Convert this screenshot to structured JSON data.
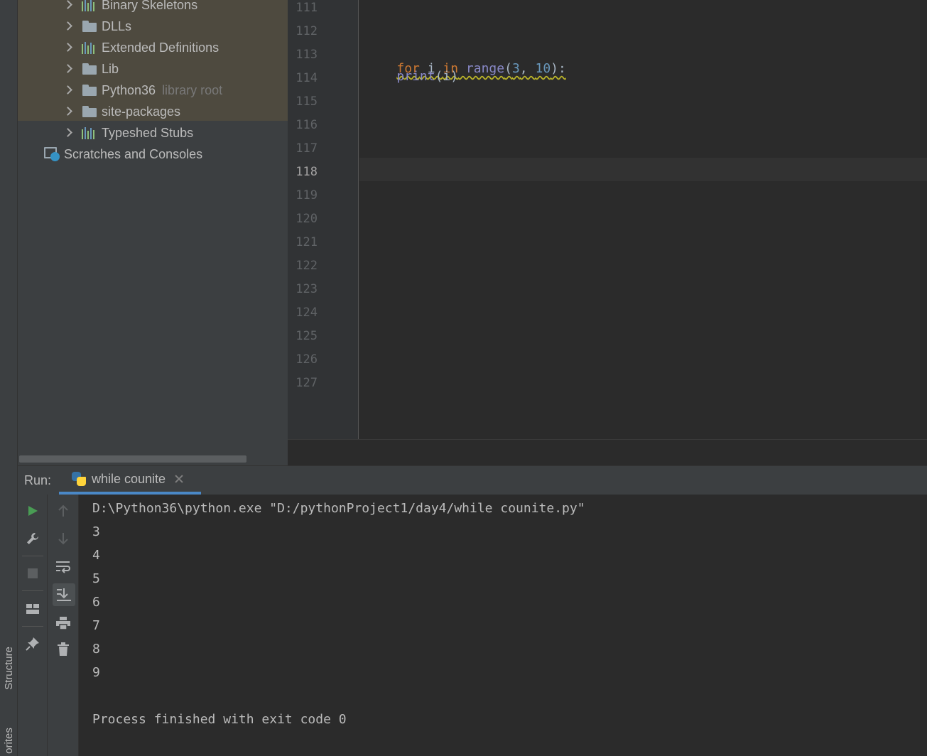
{
  "left_strip": {
    "structure_label": "Structure",
    "favorites_label": "orites"
  },
  "project_tree": {
    "items": [
      {
        "label": "Binary Skeletons",
        "icon": "library-icon"
      },
      {
        "label": "DLLs",
        "icon": "folder-icon"
      },
      {
        "label": "Extended Definitions",
        "icon": "library-icon"
      },
      {
        "label": "Lib",
        "icon": "folder-icon"
      },
      {
        "label": "Python36",
        "hint": "library root",
        "icon": "folder-icon"
      },
      {
        "label": "site-packages",
        "icon": "folder-icon"
      },
      {
        "label": "Typeshed Stubs",
        "icon": "library-icon"
      }
    ],
    "scratches_label": "Scratches and Consoles"
  },
  "editor": {
    "line_numbers": [
      "111",
      "112",
      "113",
      "114",
      "115",
      "116",
      "117",
      "118",
      "119",
      "120",
      "121",
      "122",
      "123",
      "124",
      "125",
      "126",
      "127"
    ],
    "current_line": "118",
    "code": {
      "line113": {
        "kw_for": "for",
        "var_i": " i ",
        "kw_in": "in",
        "fn_range": " range",
        "paren_open": "(",
        "n3": "3",
        "comma": ", ",
        "n10": "10",
        "paren_close": "):"
      },
      "line114": {
        "indent": "    ",
        "fn_print": "print",
        "args": "(i)"
      }
    },
    "colors": {
      "keyword": "#cc7832",
      "builtin": "#8888c6",
      "number": "#6897bb",
      "text": "#a9b7c6"
    }
  },
  "run_panel": {
    "label": "Run:",
    "tab_label": "while counite",
    "console_lines": [
      "D:\\Python36\\python.exe \"D:/pythonProject1/day4/while counite.py\"",
      "3",
      "4",
      "5",
      "6",
      "7",
      "8",
      "9",
      "",
      "Process finished with exit code 0"
    ]
  }
}
